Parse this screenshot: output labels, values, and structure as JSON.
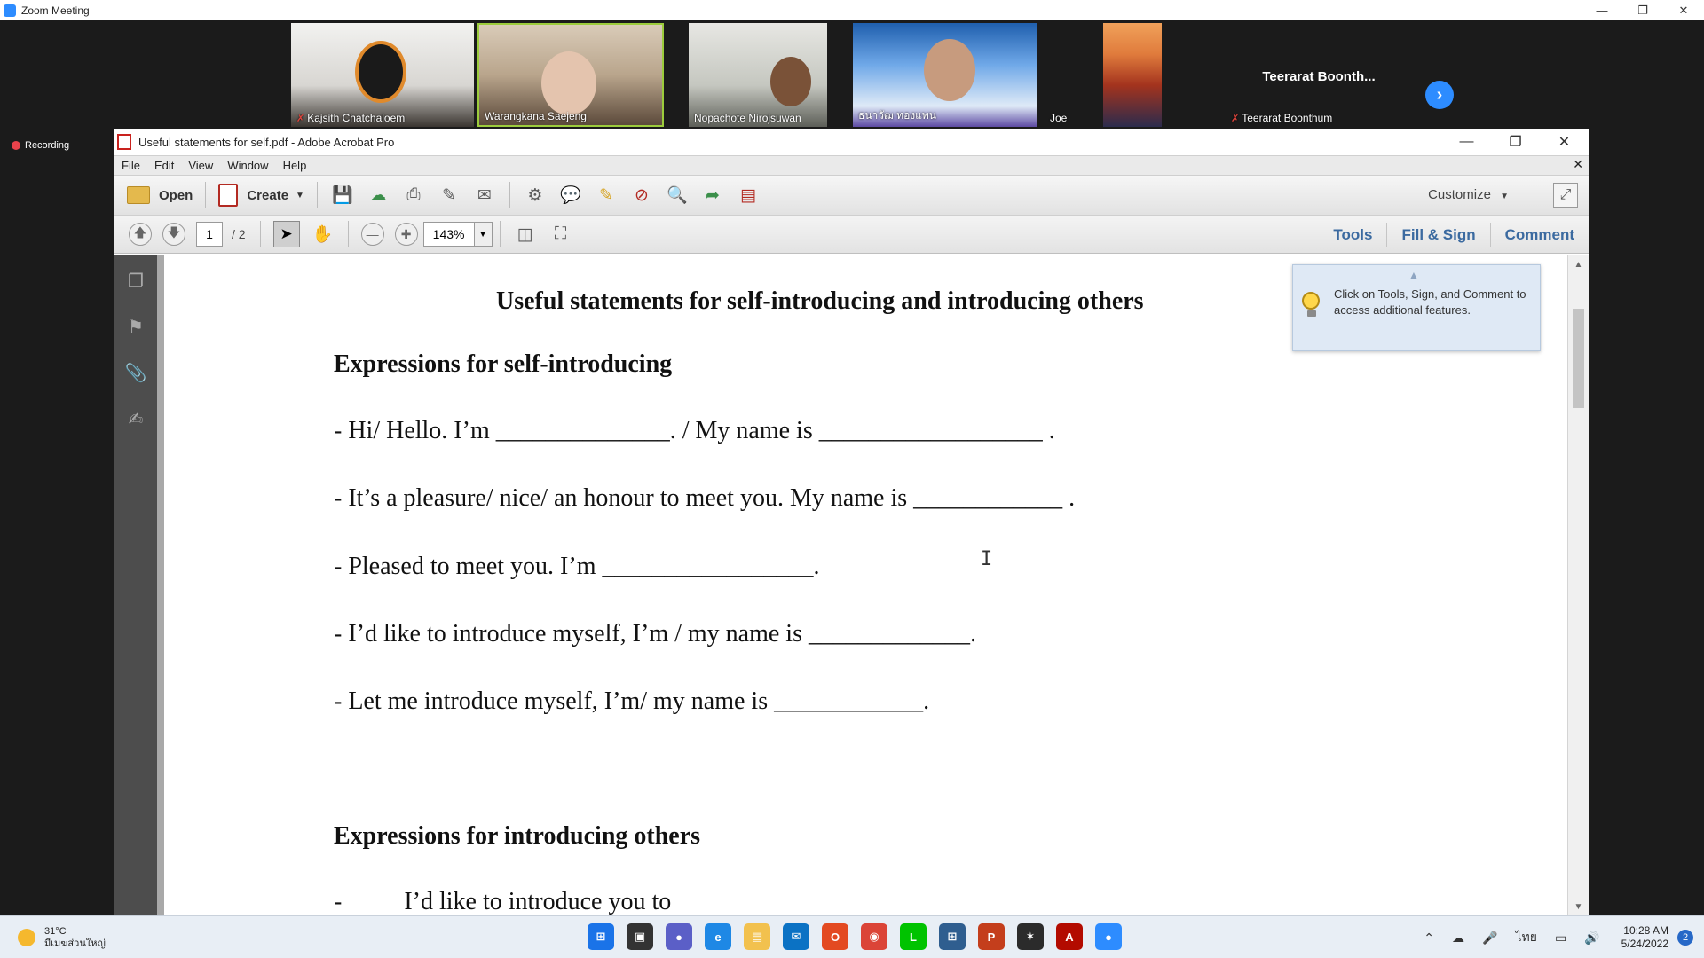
{
  "zoom": {
    "window_title": "Zoom Meeting",
    "participants": [
      {
        "name": "Kajsith Chatchaloem",
        "muted": true
      },
      {
        "name": "Warangkana Saejeng",
        "muted": false
      },
      {
        "name": "Nopachote Nirojsuwan",
        "muted": true
      },
      {
        "name": "ธนาวัฒ ทองแพน",
        "muted": false
      },
      {
        "name": "Joe",
        "muted": false
      },
      {
        "name": "Teerarat Boonthum",
        "muted": true,
        "display_name": "Teerarat  Boonth..."
      }
    ],
    "recording_label": "Recording"
  },
  "acrobat": {
    "window_title": "Useful statements for self.pdf - Adobe Acrobat Pro",
    "menu": [
      "File",
      "Edit",
      "View",
      "Window",
      "Help"
    ],
    "toolbar": {
      "open_label": "Open",
      "create_label": "Create",
      "customize_label": "Customize"
    },
    "nav": {
      "current_page": "1",
      "total_pages": "/ 2",
      "zoom": "143%"
    },
    "right_tabs": [
      "Tools",
      "Fill & Sign",
      "Comment"
    ],
    "tip": "Click on Tools, Sign, and Comment to access additional features."
  },
  "document": {
    "title": "Useful statements for self-introducing and introducing others",
    "section1": "Expressions for self-introducing",
    "lines": [
      "- Hi/ Hello. I’m ______________. / My name is __________________ .",
      "- It’s a pleasure/ nice/ an honour to meet you. My name is ____________ .",
      "- Pleased to meet you. I’m _________________.",
      "- I’d like to introduce myself, I’m / my name is _____________.",
      "- Let me introduce myself, I’m/ my name is ____________."
    ],
    "section2": "Expressions for introducing others",
    "partial_line": "-          I’d like to introduce you to"
  },
  "taskbar": {
    "weather_temp": "31°C",
    "weather_desc": "มีเมฆส่วนใหญ่",
    "input_lang": "ไทย",
    "time": "10:28 AM",
    "date": "5/24/2022",
    "notification_count": "2"
  },
  "colors": {
    "zoom_blue": "#2d8cff",
    "recording_red": "#e8424b",
    "acrobat_link": "#3b6aa0"
  }
}
